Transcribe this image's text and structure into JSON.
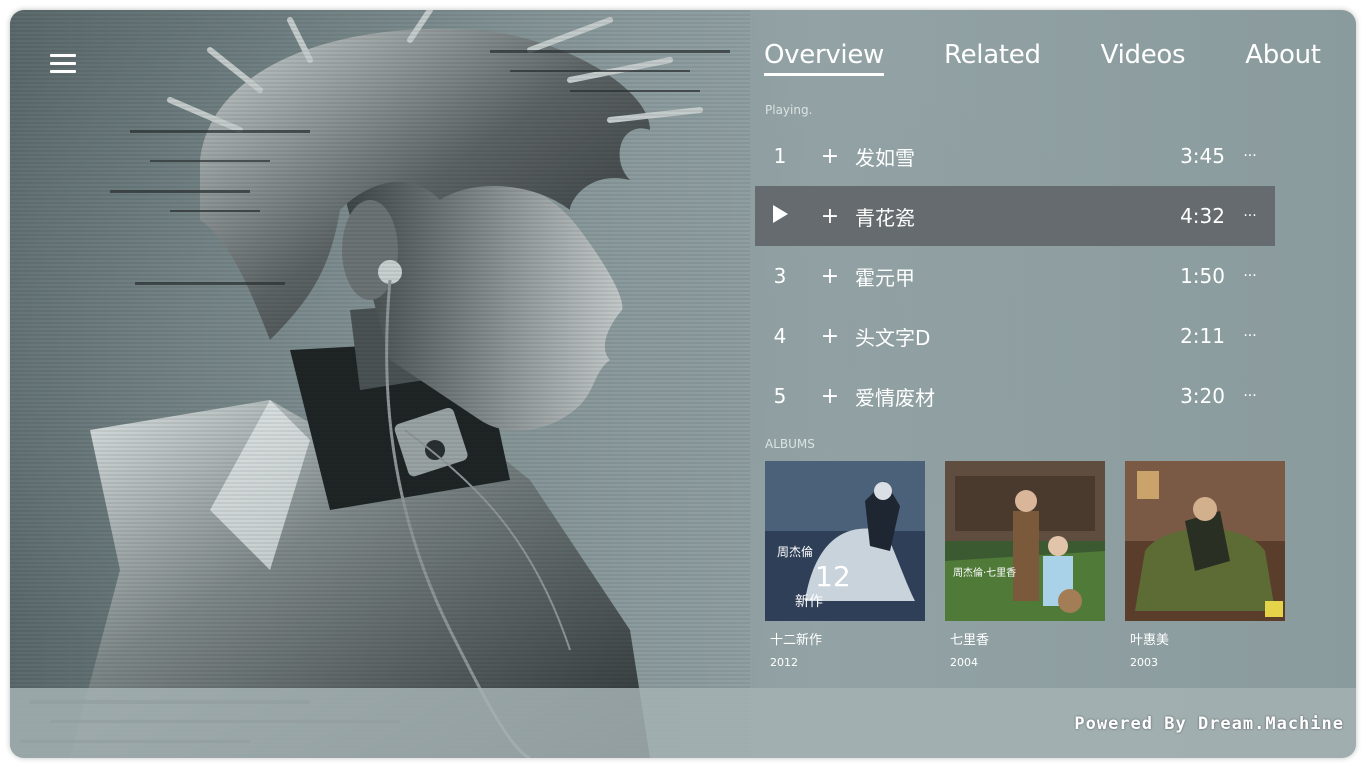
{
  "tabs": [
    {
      "label": "Overview",
      "active": true
    },
    {
      "label": "Related",
      "active": false
    },
    {
      "label": "Videos",
      "active": false
    },
    {
      "label": "About",
      "active": false
    }
  ],
  "playing_label": "Playing.",
  "tracks": [
    {
      "num": "1",
      "title": "发如雪",
      "duration": "3:45",
      "add": "+",
      "more": "···",
      "playing": false
    },
    {
      "num": "2",
      "title": "青花瓷",
      "duration": "4:32",
      "add": "+",
      "more": "···",
      "playing": true
    },
    {
      "num": "3",
      "title": "霍元甲",
      "duration": "1:50",
      "add": "+",
      "more": "···",
      "playing": false
    },
    {
      "num": "4",
      "title": "头文字D",
      "duration": "2:11",
      "add": "+",
      "more": "···",
      "playing": false
    },
    {
      "num": "5",
      "title": "爱情废材",
      "duration": "3:20",
      "add": "+",
      "more": "···",
      "playing": false
    }
  ],
  "albums_label": "ALBUMS",
  "albums": [
    {
      "title": "十二新作",
      "year": "2012"
    },
    {
      "title": "七里香",
      "year": "2004"
    },
    {
      "title": "叶惠美",
      "year": "2003"
    }
  ],
  "footer": {
    "text": "Powered By Dream.Machine"
  },
  "colors": {
    "accent": "#ffffff",
    "active_row": "#656b6e",
    "footer_bg": "#a5b2b3"
  },
  "icons": {
    "menu": "hamburger-icon",
    "play": "play-icon",
    "add": "plus-icon",
    "more": "ellipsis-icon"
  }
}
